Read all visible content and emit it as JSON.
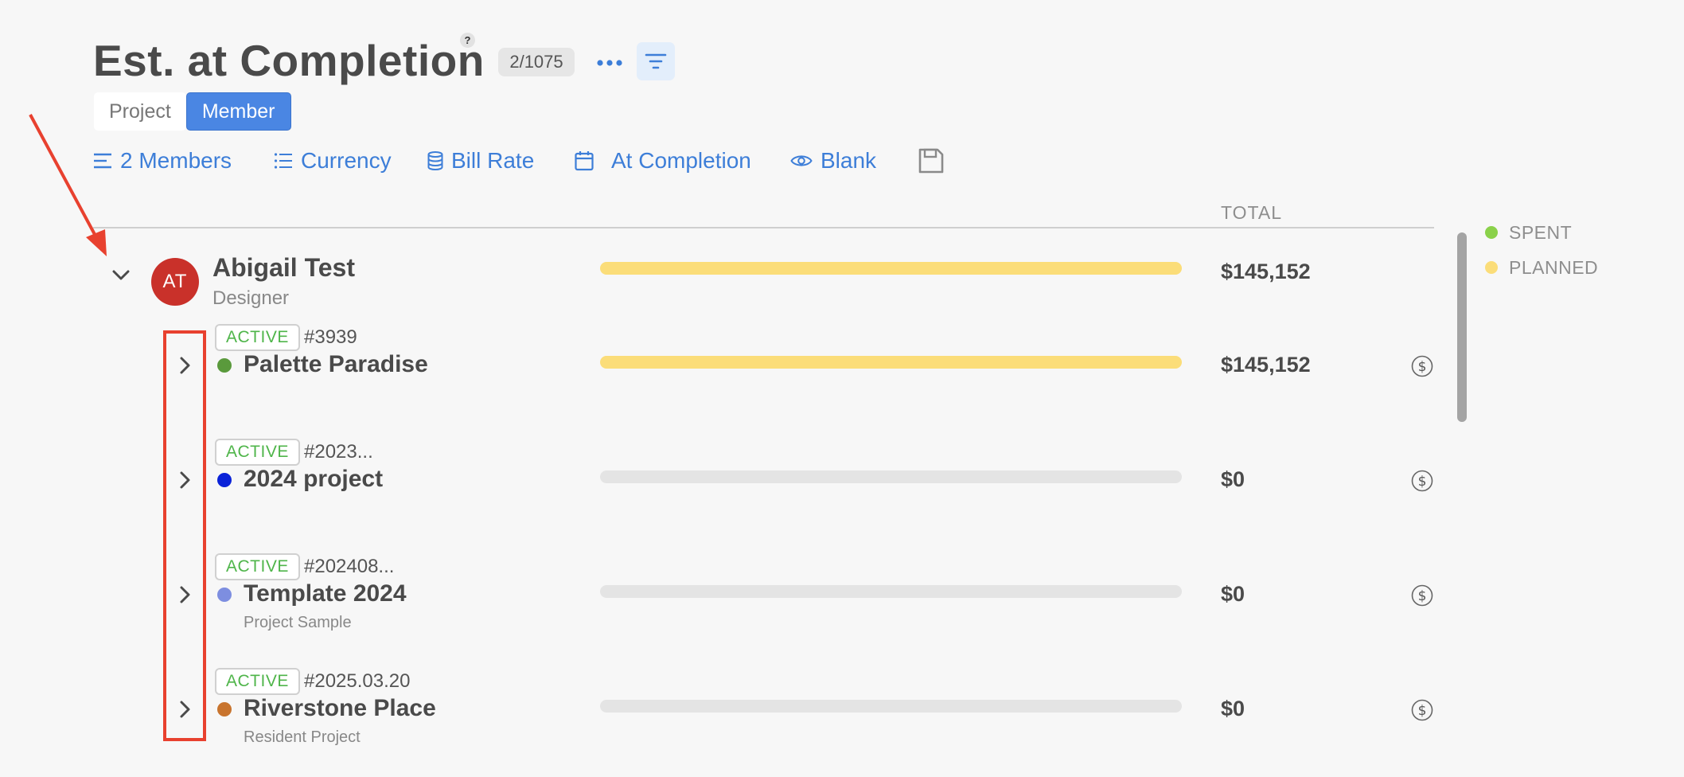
{
  "header": {
    "title": "Est. at Completion",
    "help": "?",
    "count": "2/1075",
    "more_icon": "ellipsis-icon",
    "filter_icon": "filter-icon"
  },
  "view_toggle": {
    "options": [
      {
        "label": "Project",
        "active": false
      },
      {
        "label": "Member",
        "active": true
      }
    ]
  },
  "toolbar": {
    "members": "2 Members",
    "currency": "Currency",
    "bill_rate": "Bill Rate",
    "at_completion": "At Completion",
    "blank": "Blank",
    "save_icon": "save-icon"
  },
  "table": {
    "total_header": "TOTAL"
  },
  "legend": {
    "spent": {
      "label": "SPENT",
      "color": "#8ad14a"
    },
    "planned": {
      "label": "PLANNED",
      "color": "#fbdd79"
    }
  },
  "member": {
    "initials": "AT",
    "avatar_color": "#c9312a",
    "name": "Abigail Test",
    "role": "Designer",
    "total": "$145,152",
    "planned_fraction": 1.0
  },
  "projects": [
    {
      "status": "ACTIVE",
      "number": "#3939",
      "name": "Palette Paradise",
      "subtitle": "",
      "dot_color": "#5a9a3c",
      "total": "$145,152",
      "planned_fraction": 1.0
    },
    {
      "status": "ACTIVE",
      "number": "#2023...",
      "name": "2024 project",
      "subtitle": "",
      "dot_color": "#0a22d8",
      "total": "$0",
      "planned_fraction": 0
    },
    {
      "status": "ACTIVE",
      "number": "#202408...",
      "name": "Template 2024",
      "subtitle": "Project Sample",
      "dot_color": "#7d8ee0",
      "total": "$0",
      "planned_fraction": 0
    },
    {
      "status": "ACTIVE",
      "number": "#2025.03.20",
      "name": "Riverstone Place",
      "subtitle": "Resident Project",
      "dot_color": "#c8742e",
      "total": "$0",
      "planned_fraction": 0
    }
  ],
  "colors": {
    "accent": "#3d7ed8",
    "active_toggle": "#4a86e3",
    "status_active": "#4fb54a",
    "annotation": "#e8412f"
  }
}
